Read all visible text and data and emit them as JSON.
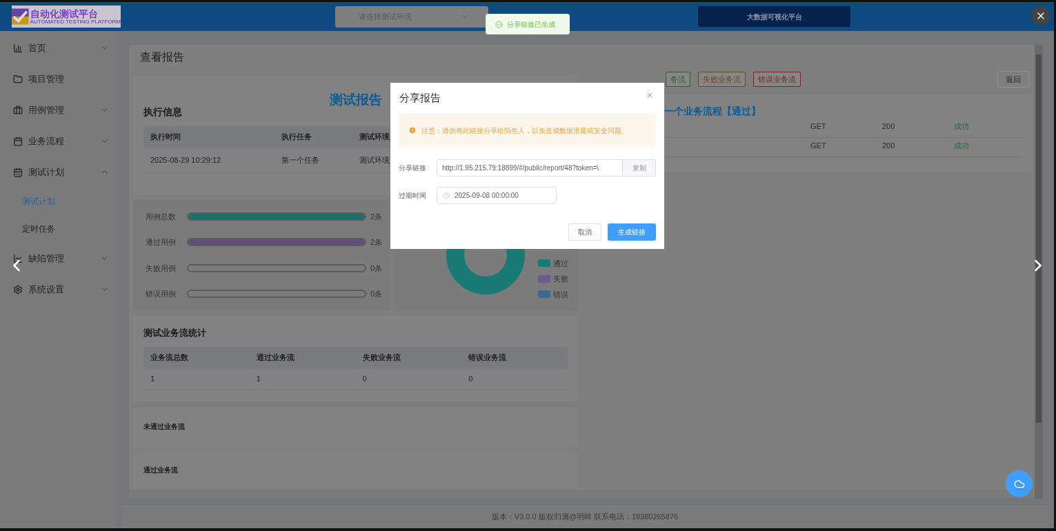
{
  "header": {
    "logo_title": "自动化测试平台",
    "logo_subtitle": "AUTOMATED TESTING PLATFORM",
    "env_select": {
      "placeholder": "请选择测试环境"
    },
    "bigdata_button": "大数据可视化平台"
  },
  "toast": {
    "message": "分享链接已生成"
  },
  "sidebar": {
    "items": [
      {
        "label": "首页",
        "kind": "group",
        "expanded": false
      },
      {
        "label": "项目管理",
        "kind": "link"
      },
      {
        "label": "用例管理",
        "kind": "group",
        "expanded": false
      },
      {
        "label": "业务流程",
        "kind": "group",
        "expanded": false
      },
      {
        "label": "测试计划",
        "kind": "group",
        "expanded": true,
        "children": [
          {
            "label": "测试计划",
            "selected": true
          },
          {
            "label": "定时任务",
            "selected": false
          }
        ]
      },
      {
        "label": "缺陷管理",
        "kind": "group",
        "expanded": false
      },
      {
        "label": "系统设置",
        "kind": "group",
        "expanded": false
      }
    ]
  },
  "page": {
    "title": "查看报告",
    "report_title": "测试报告",
    "exec_info": {
      "heading": "执行信息",
      "columns": [
        "执行时间",
        "执行任务",
        "测试环境"
      ],
      "rows": [
        [
          "2025-08-29 10:29:12",
          "第一个任务",
          "测试环境"
        ]
      ]
    },
    "case_stats": [
      {
        "label": "用例总数",
        "count": "2条",
        "level": 1,
        "color": "#1b6e6a"
      },
      {
        "label": "通过用例",
        "count": "2条",
        "level": 1,
        "color": "#5f4f7a"
      },
      {
        "label": "失败用例",
        "count": "0条",
        "level": 0
      },
      {
        "label": "错误用例",
        "count": "0条",
        "level": 0
      }
    ],
    "legend": [
      {
        "label": "通过",
        "color": "#1a7a75"
      },
      {
        "label": "失败",
        "color": "#6e5a8a"
      },
      {
        "label": "错误",
        "color": "#3a6a95"
      }
    ],
    "flow_stats": {
      "heading": "测试业务流统计",
      "columns": [
        "业务流总数",
        "通过业务流",
        "失败业务流",
        "错误业务流"
      ],
      "rows": [
        [
          "1",
          "1",
          "0",
          "0"
        ]
      ]
    },
    "sections": [
      "未通过业务流",
      "通过业务流"
    ],
    "tags": [
      {
        "label": "务流",
        "color": "#2f5f2f"
      },
      {
        "label": "失败业务流",
        "color": "#6a4a1a"
      },
      {
        "label": "错误业务流",
        "color": "#7a2525"
      }
    ],
    "back_button": "返回",
    "flow_card": {
      "title": "一个业务流程【通过】",
      "rows": [
        {
          "method": "GET",
          "status": "200",
          "result": "成功"
        },
        {
          "method": "GET",
          "status": "200",
          "result": "成功"
        }
      ]
    }
  },
  "footer": "版本：V3.0.0 版权归属@明眸 联系电话：18380265876",
  "modal": {
    "title": "分享报告",
    "alert": "注意：请勿将此链接分享给陌生人，以免造成数据泄露或安全问题。",
    "link_label": "分享链接",
    "link_value": "http://1.95.215.79:18899/#/public/report/48?token=\\",
    "copy_button": "复制",
    "expire_label": "过期时间",
    "expire_value": "2025-09-08 00:00:00",
    "cancel_button": "取消",
    "confirm_button": "生成链接"
  }
}
